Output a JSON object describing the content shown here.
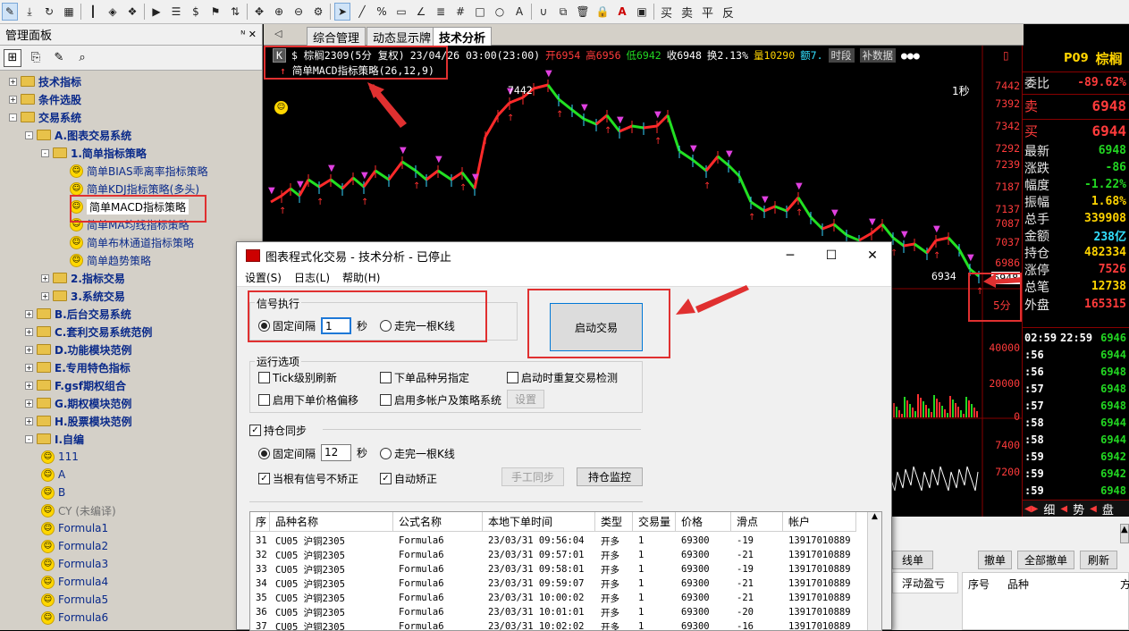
{
  "toolbar": {
    "icons": [
      "pen-icon",
      "download-icon",
      "refresh-icon",
      "grid-icon",
      "bar-indicator-icon",
      "diamond-icon",
      "layers-icon",
      "play-icon",
      "doc-icon",
      "dollar-icon",
      "flag-icon",
      "swap-icon",
      "move-icon",
      "zoom-in-icon",
      "zoom-out-icon",
      "gear-icon",
      "cursor-icon",
      "line-icon",
      "percent-icon",
      "ruler-icon",
      "angle-icon",
      "bars-icon",
      "hash-icon",
      "rect-icon",
      "circle-icon",
      "text-icon",
      "magnet-icon",
      "copy-icon",
      "trash-icon",
      "lock-icon",
      "color-icon",
      "save-icon"
    ],
    "buy": "买",
    "sell": "卖",
    "flat": "平",
    "reverse": "反"
  },
  "left_panel": {
    "title": "管理面板",
    "pin": "ᴺ ✕",
    "tree": [
      {
        "label": "技术指标",
        "type": "folder",
        "level": 0,
        "exp": "+"
      },
      {
        "label": "条件选股",
        "type": "folder",
        "level": 0,
        "exp": "+"
      },
      {
        "label": "交易系统",
        "type": "folder",
        "level": 0,
        "exp": "-"
      },
      {
        "label": "A.图表交易系统",
        "type": "folder",
        "level": 1,
        "exp": "-"
      },
      {
        "label": "1.简单指标策略",
        "type": "folder",
        "level": 2,
        "exp": "-"
      },
      {
        "label": "简单BIAS乖离率指标策略",
        "type": "leaf",
        "level": 3
      },
      {
        "label": "简单KDJ指标策略(多头)",
        "type": "leaf",
        "level": 3
      },
      {
        "label": "简单MACD指标策略",
        "type": "leaf",
        "level": 3,
        "selected": true
      },
      {
        "label": "简单MA均线指标策略",
        "type": "leaf",
        "level": 3
      },
      {
        "label": "简单布林通道指标策略",
        "type": "leaf",
        "level": 3
      },
      {
        "label": "简单趋势策略",
        "type": "leaf",
        "level": 3
      },
      {
        "label": "2.指标交易",
        "type": "folder",
        "level": 2,
        "exp": "+"
      },
      {
        "label": "3.系统交易",
        "type": "folder",
        "level": 2,
        "exp": "+"
      },
      {
        "label": "B.后台交易系统",
        "type": "folder",
        "level": 1,
        "exp": "+"
      },
      {
        "label": "C.套利交易系统范例",
        "type": "folder",
        "level": 1,
        "exp": "+"
      },
      {
        "label": "D.功能模块范例",
        "type": "folder",
        "level": 1,
        "exp": "+"
      },
      {
        "label": "E.专用特色指标",
        "type": "folder",
        "level": 1,
        "exp": "+"
      },
      {
        "label": "F.gsf期权组合",
        "type": "folder",
        "level": 1,
        "exp": "+"
      },
      {
        "label": "G.期权模块范例",
        "type": "folder",
        "level": 1,
        "exp": "+"
      },
      {
        "label": "H.股票模块范例",
        "type": "folder",
        "level": 1,
        "exp": "+"
      },
      {
        "label": "I.自编",
        "type": "folder",
        "level": 1,
        "exp": "-"
      },
      {
        "label": "111",
        "type": "leaf",
        "level": 2
      },
      {
        "label": "A",
        "type": "leaf",
        "level": 2
      },
      {
        "label": "B",
        "type": "leaf",
        "level": 2
      },
      {
        "label": "CY (未编译)",
        "type": "leaf",
        "level": 2,
        "gray": true
      },
      {
        "label": "Formula1",
        "type": "leaf",
        "level": 2
      },
      {
        "label": "Formula2",
        "type": "leaf",
        "level": 2
      },
      {
        "label": "Formula3",
        "type": "leaf",
        "level": 2
      },
      {
        "label": "Formula4",
        "type": "leaf",
        "level": 2
      },
      {
        "label": "Formula5",
        "type": "leaf",
        "level": 2
      },
      {
        "label": "Formula6",
        "type": "leaf",
        "level": 2
      }
    ]
  },
  "tabs": [
    "综合管理",
    "动态显示牌",
    "技术分析"
  ],
  "chart": {
    "k_btn": "K",
    "symbol": "$ 棕榈2309(5分 复权)",
    "datetime": "23/04/26 03:00(23:00)",
    "open": "开6954",
    "high": "高6956",
    "low": "低6942",
    "close": "收6948",
    "change": "换2.13%",
    "volume": "量10290",
    "extra": "额7.",
    "btn_period": "时段",
    "btn_supplement": "补数据",
    "strategy": "简单MACD指标策略(26,12,9)",
    "peak_label": "7442",
    "last_price_label": "6934",
    "interval_label": "1秒",
    "period_label": "5分",
    "price_axis": [
      "7442",
      "7392",
      "7342",
      "7292",
      "7239",
      "7187",
      "7137",
      "7087",
      "7037",
      "6986",
      "6948"
    ],
    "vol_axis": [
      "40000",
      "20000",
      "0"
    ],
    "sub_axis": [
      "7400",
      "7200"
    ]
  },
  "quote": {
    "code": "P09",
    "name": "棕榈",
    "rows": [
      {
        "k": "委比",
        "v": "-89.62%",
        "c": "#ff3b3b"
      },
      {
        "k": "卖",
        "v": "6948",
        "c": "#ff3b3b"
      },
      {
        "k": "买",
        "v": "6944",
        "c": "#ff3b3b"
      },
      {
        "k": "最新",
        "v": "6948",
        "c": "#22d622"
      },
      {
        "k": "涨跌",
        "v": "-86",
        "c": "#22d622"
      },
      {
        "k": "幅度",
        "v": "-1.22%",
        "c": "#22d622"
      },
      {
        "k": "振幅",
        "v": "1.68%",
        "c": "#ffd400"
      },
      {
        "k": "总手",
        "v": "339908",
        "c": "#ffd400"
      },
      {
        "k": "金额",
        "v": "238亿",
        "c": "#33e0ff"
      },
      {
        "k": "持仓",
        "v": "482334",
        "c": "#ffd400"
      },
      {
        "k": "涨停",
        "v": "7526",
        "c": "#ff3b3b"
      },
      {
        "k": "总笔",
        "v": "12738",
        "c": "#ffd400"
      },
      {
        "k": "外盘",
        "v": "165315",
        "c": "#ff3b3b"
      }
    ],
    "ticks": [
      {
        "t": "02:59",
        "t2": "22:59",
        "p": "6946"
      },
      {
        "t": ":56",
        "t2": "",
        "p": "6944"
      },
      {
        "t": ":56",
        "t2": "",
        "p": "6948"
      },
      {
        "t": ":57",
        "t2": "",
        "p": "6948"
      },
      {
        "t": ":57",
        "t2": "",
        "p": "6948"
      },
      {
        "t": ":58",
        "t2": "",
        "p": "6944"
      },
      {
        "t": ":58",
        "t2": "",
        "p": "6944"
      },
      {
        "t": ":59",
        "t2": "",
        "p": "6942"
      },
      {
        "t": ":59",
        "t2": "",
        "p": "6942"
      },
      {
        "t": ":59",
        "t2": "",
        "p": "6948"
      }
    ],
    "bottom_tabs": [
      "细",
      "势",
      "盘"
    ]
  },
  "dialog": {
    "title": "图表程式化交易 - 技术分析 - 已停止",
    "menu": [
      "设置(S)",
      "日志(L)",
      "帮助(H)"
    ],
    "signal_group": "信号执行",
    "fixed_interval": "固定间隔",
    "interval_value": "1",
    "seconds": "秒",
    "bar_complete": "走完一根K线",
    "start_button": "启动交易",
    "options_group": "运行选项",
    "opt_tick": "Tick级别刷新",
    "opt_other_symbol": "下单品种另指定",
    "opt_restart_check": "启动时重复交易检测",
    "opt_price_offset": "启用下单价格偏移",
    "opt_multi_account": "启用多帐户及策略系统",
    "settings_btn": "设置",
    "position_sync": "持仓同步",
    "sync_interval_value": "12",
    "opt_no_correct": "当根有信号不矫正",
    "opt_auto_correct": "自动矫正",
    "manual_sync_btn": "手工同步",
    "position_monitor_btn": "持仓监控",
    "table": {
      "headers": [
        "序",
        "品种名称",
        "公式名称",
        "本地下单时间",
        "类型",
        "交易量",
        "价格",
        "滑点",
        "帐户"
      ],
      "rows": [
        [
          "31",
          "CU05 沪铜2305",
          "Formula6",
          "23/03/31 09:56:04",
          "开多",
          "1",
          "69300",
          "-19",
          "13917010889"
        ],
        [
          "32",
          "CU05 沪铜2305",
          "Formula6",
          "23/03/31 09:57:01",
          "开多",
          "1",
          "69300",
          "-21",
          "13917010889"
        ],
        [
          "33",
          "CU05 沪铜2305",
          "Formula6",
          "23/03/31 09:58:01",
          "开多",
          "1",
          "69300",
          "-19",
          "13917010889"
        ],
        [
          "34",
          "CU05 沪铜2305",
          "Formula6",
          "23/03/31 09:59:07",
          "开多",
          "1",
          "69300",
          "-21",
          "13917010889"
        ],
        [
          "35",
          "CU05 沪铜2305",
          "Formula6",
          "23/03/31 10:00:02",
          "开多",
          "1",
          "69300",
          "-21",
          "13917010889"
        ],
        [
          "36",
          "CU05 沪铜2305",
          "Formula6",
          "23/03/31 10:01:01",
          "开多",
          "1",
          "69300",
          "-20",
          "13917010889"
        ],
        [
          "37",
          "CU05 沪铜2305",
          "Formula6",
          "23/03/31 10:02:02",
          "开多",
          "1",
          "69300",
          "-16",
          "13917010889"
        ]
      ]
    }
  },
  "bottom_right": {
    "line_order": "线单",
    "cancel": "撤单",
    "cancel_all": "全部撤单",
    "refresh": "刷新",
    "float_pnl": "浮动盈亏",
    "col_seq": "序号",
    "col_symbol": "品种",
    "col_dir": "方"
  }
}
